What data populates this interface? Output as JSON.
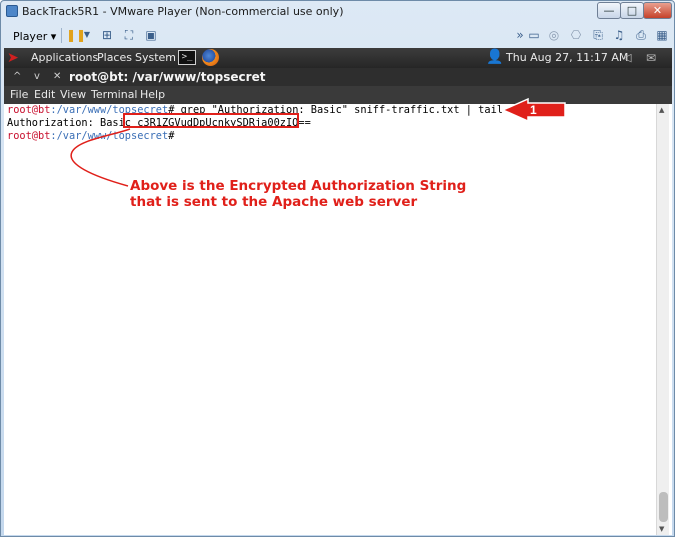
{
  "window": {
    "title": "BackTrack5R1 - VMware Player (Non-commercial use only)",
    "controls": {
      "minimize": "—",
      "maximize": "□",
      "close": "✕"
    }
  },
  "vm_toolbar": {
    "player_menu": "Player ▾",
    "icons": [
      "pause-icon",
      "dropdown-icon",
      "network-icon",
      "fullscreen-icon",
      "unity-icon"
    ],
    "right_icons": [
      "chevron-double-right-icon",
      "drive-icon",
      "cd-icon",
      "usb-icon",
      "usb-icon",
      "sound-icon",
      "printer-icon",
      "cpu-icon"
    ]
  },
  "gnome_panel": {
    "menus": [
      "Applications",
      "Places",
      "System"
    ],
    "clock": "Thu Aug 27, 11:17 AM"
  },
  "terminal": {
    "title": "root@bt: /var/www/topsecret",
    "menus": [
      "File",
      "Edit",
      "View",
      "Terminal",
      "Help"
    ],
    "lines": [
      {
        "user": "root@bt",
        "path": ":/var/www/topsecret",
        "rest": "# grep \"Authorization: Basic\" sniff-traffic.txt | tail -1"
      },
      {
        "plain": "Authorization: Basic ",
        "highlight": "c3R1ZGVudDpUcnkySDRja00zIQ=="
      },
      {
        "user": "root@bt",
        "path": ":/var/www/topsecret",
        "rest": "#"
      }
    ]
  },
  "annotations": {
    "step_number": "1",
    "note_line1": "Above is the Encrypted Authorization String",
    "note_line2": "that is sent to the Apache web server",
    "color": "#e0201a"
  }
}
